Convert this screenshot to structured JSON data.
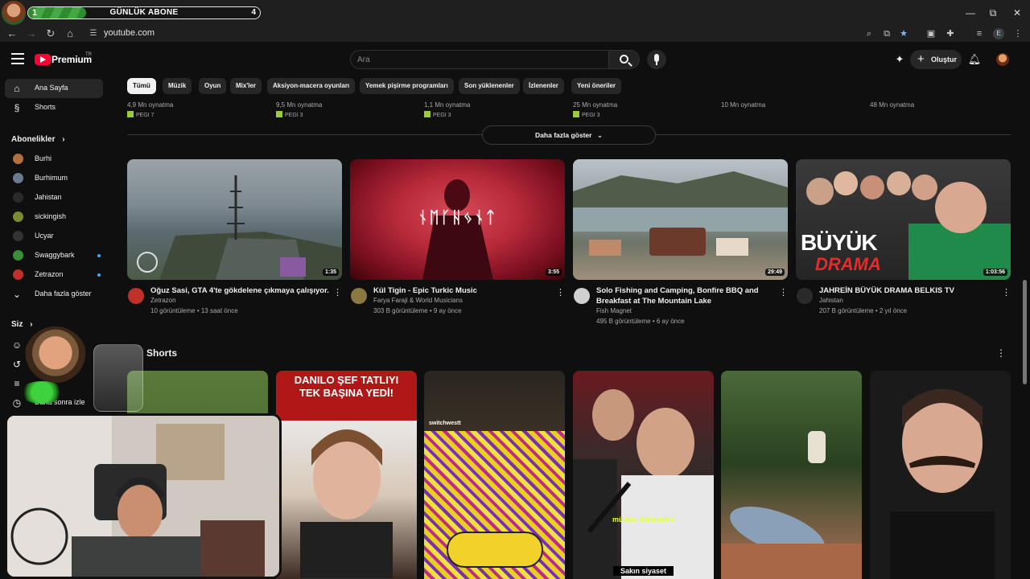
{
  "overlay": {
    "subscriber_goal": {
      "start": "1",
      "label": "GÜNLÜK ABONE",
      "end": "4",
      "progress": 0.25
    }
  },
  "window_controls": {
    "minimize": "—",
    "maximize": "⧉",
    "close": "✕"
  },
  "browser": {
    "url": "youtube.com",
    "profile_initial": "E"
  },
  "header": {
    "brand": "Premium",
    "country": "TR",
    "search_placeholder": "Ara",
    "create_label": "Oluştur"
  },
  "sidebar": {
    "primary": [
      {
        "label": "Ana Sayfa",
        "icon": "home-icon"
      },
      {
        "label": "Shorts",
        "icon": "shorts-icon"
      }
    ],
    "subscriptions_title": "Abonelikler",
    "subscriptions": [
      {
        "label": "Burhi",
        "color": "#b07040",
        "live": false
      },
      {
        "label": "Burhimum",
        "color": "#6a7a90",
        "live": false
      },
      {
        "label": "Jahistan",
        "color": "#2a2a2a",
        "live": false
      },
      {
        "label": "sickingish",
        "color": "#7a8a30",
        "live": false
      },
      {
        "label": "Ucyar",
        "color": "#333333",
        "live": false
      },
      {
        "label": "Swaggybark",
        "color": "#3b8f3b",
        "live": true
      },
      {
        "label": "Zetrazon",
        "color": "#c0302a",
        "live": true
      }
    ],
    "show_more": "Daha fazla göster",
    "you_title": "Siz",
    "watch_later": "Daha sonra izle"
  },
  "chips": [
    "Tümü",
    "Müzik",
    "Oyun",
    "Mix'ler",
    "Aksiyon-macera oyunları",
    "Yemek pişirme programları",
    "Son yüklenenler",
    "İzlenenler",
    "Yeni öneriler"
  ],
  "previous_row": [
    {
      "plays": "4,9 Mn oynatma",
      "rating": "PEGI 7"
    },
    {
      "plays": "9,5 Mn oynatma",
      "rating": "PEGI 3"
    },
    {
      "plays": "1,1 Mn oynatma",
      "rating": "PEGI 3"
    },
    {
      "plays": "25 Mn oynatma",
      "rating": "PEGI 3"
    },
    {
      "plays": "10 Mn oynatma",
      "rating": ""
    },
    {
      "plays": "48 Mn oynatma",
      "rating": ""
    }
  ],
  "show_more_button": "Daha fazla göster",
  "videos": [
    {
      "title": "Oğuz Sasi, GTA 4'te gökdelene çıkmaya çalışıyor.",
      "channel": "Zetrazon",
      "stats": "10 görüntüleme • 13 saat önce",
      "duration": "1:35"
    },
    {
      "title": "Kül Tigin - Epic Turkic Music",
      "channel": "Farya Faraji & World Musicians",
      "stats": "303 B görüntüleme • 9 ay önce",
      "duration": "3:55",
      "thumb_text": "ᚾᛖᚴᚺᛃᚾᛏ"
    },
    {
      "title": "Solo Fishing and Camping, Bonfire BBQ and Breakfast at The Mountain Lake",
      "channel": "Fish Magnet",
      "stats": "495 B görüntüleme • 6 ay önce",
      "duration": "29:49"
    },
    {
      "title": "JAHREİN BÜYÜK DRAMA BELKIS TV",
      "channel": "Jahistan",
      "stats": "207 B görüntüleme • 2 yıl önce",
      "duration": "1:03:56",
      "thumb_text_1": "BÜYÜK",
      "thumb_text_2": "DRAMA"
    }
  ],
  "shorts": {
    "title": "Shorts",
    "items": [
      {
        "caption": ""
      },
      {
        "caption": "DANILO ŞEF TATLIYI TEK BAŞINA YEDİ!"
      },
      {
        "caption": "switchwestt"
      },
      {
        "caption": "mülteci konusunu",
        "caption2": "Sakın siyaset"
      },
      {
        "caption": ""
      },
      {
        "caption": ""
      }
    ]
  }
}
